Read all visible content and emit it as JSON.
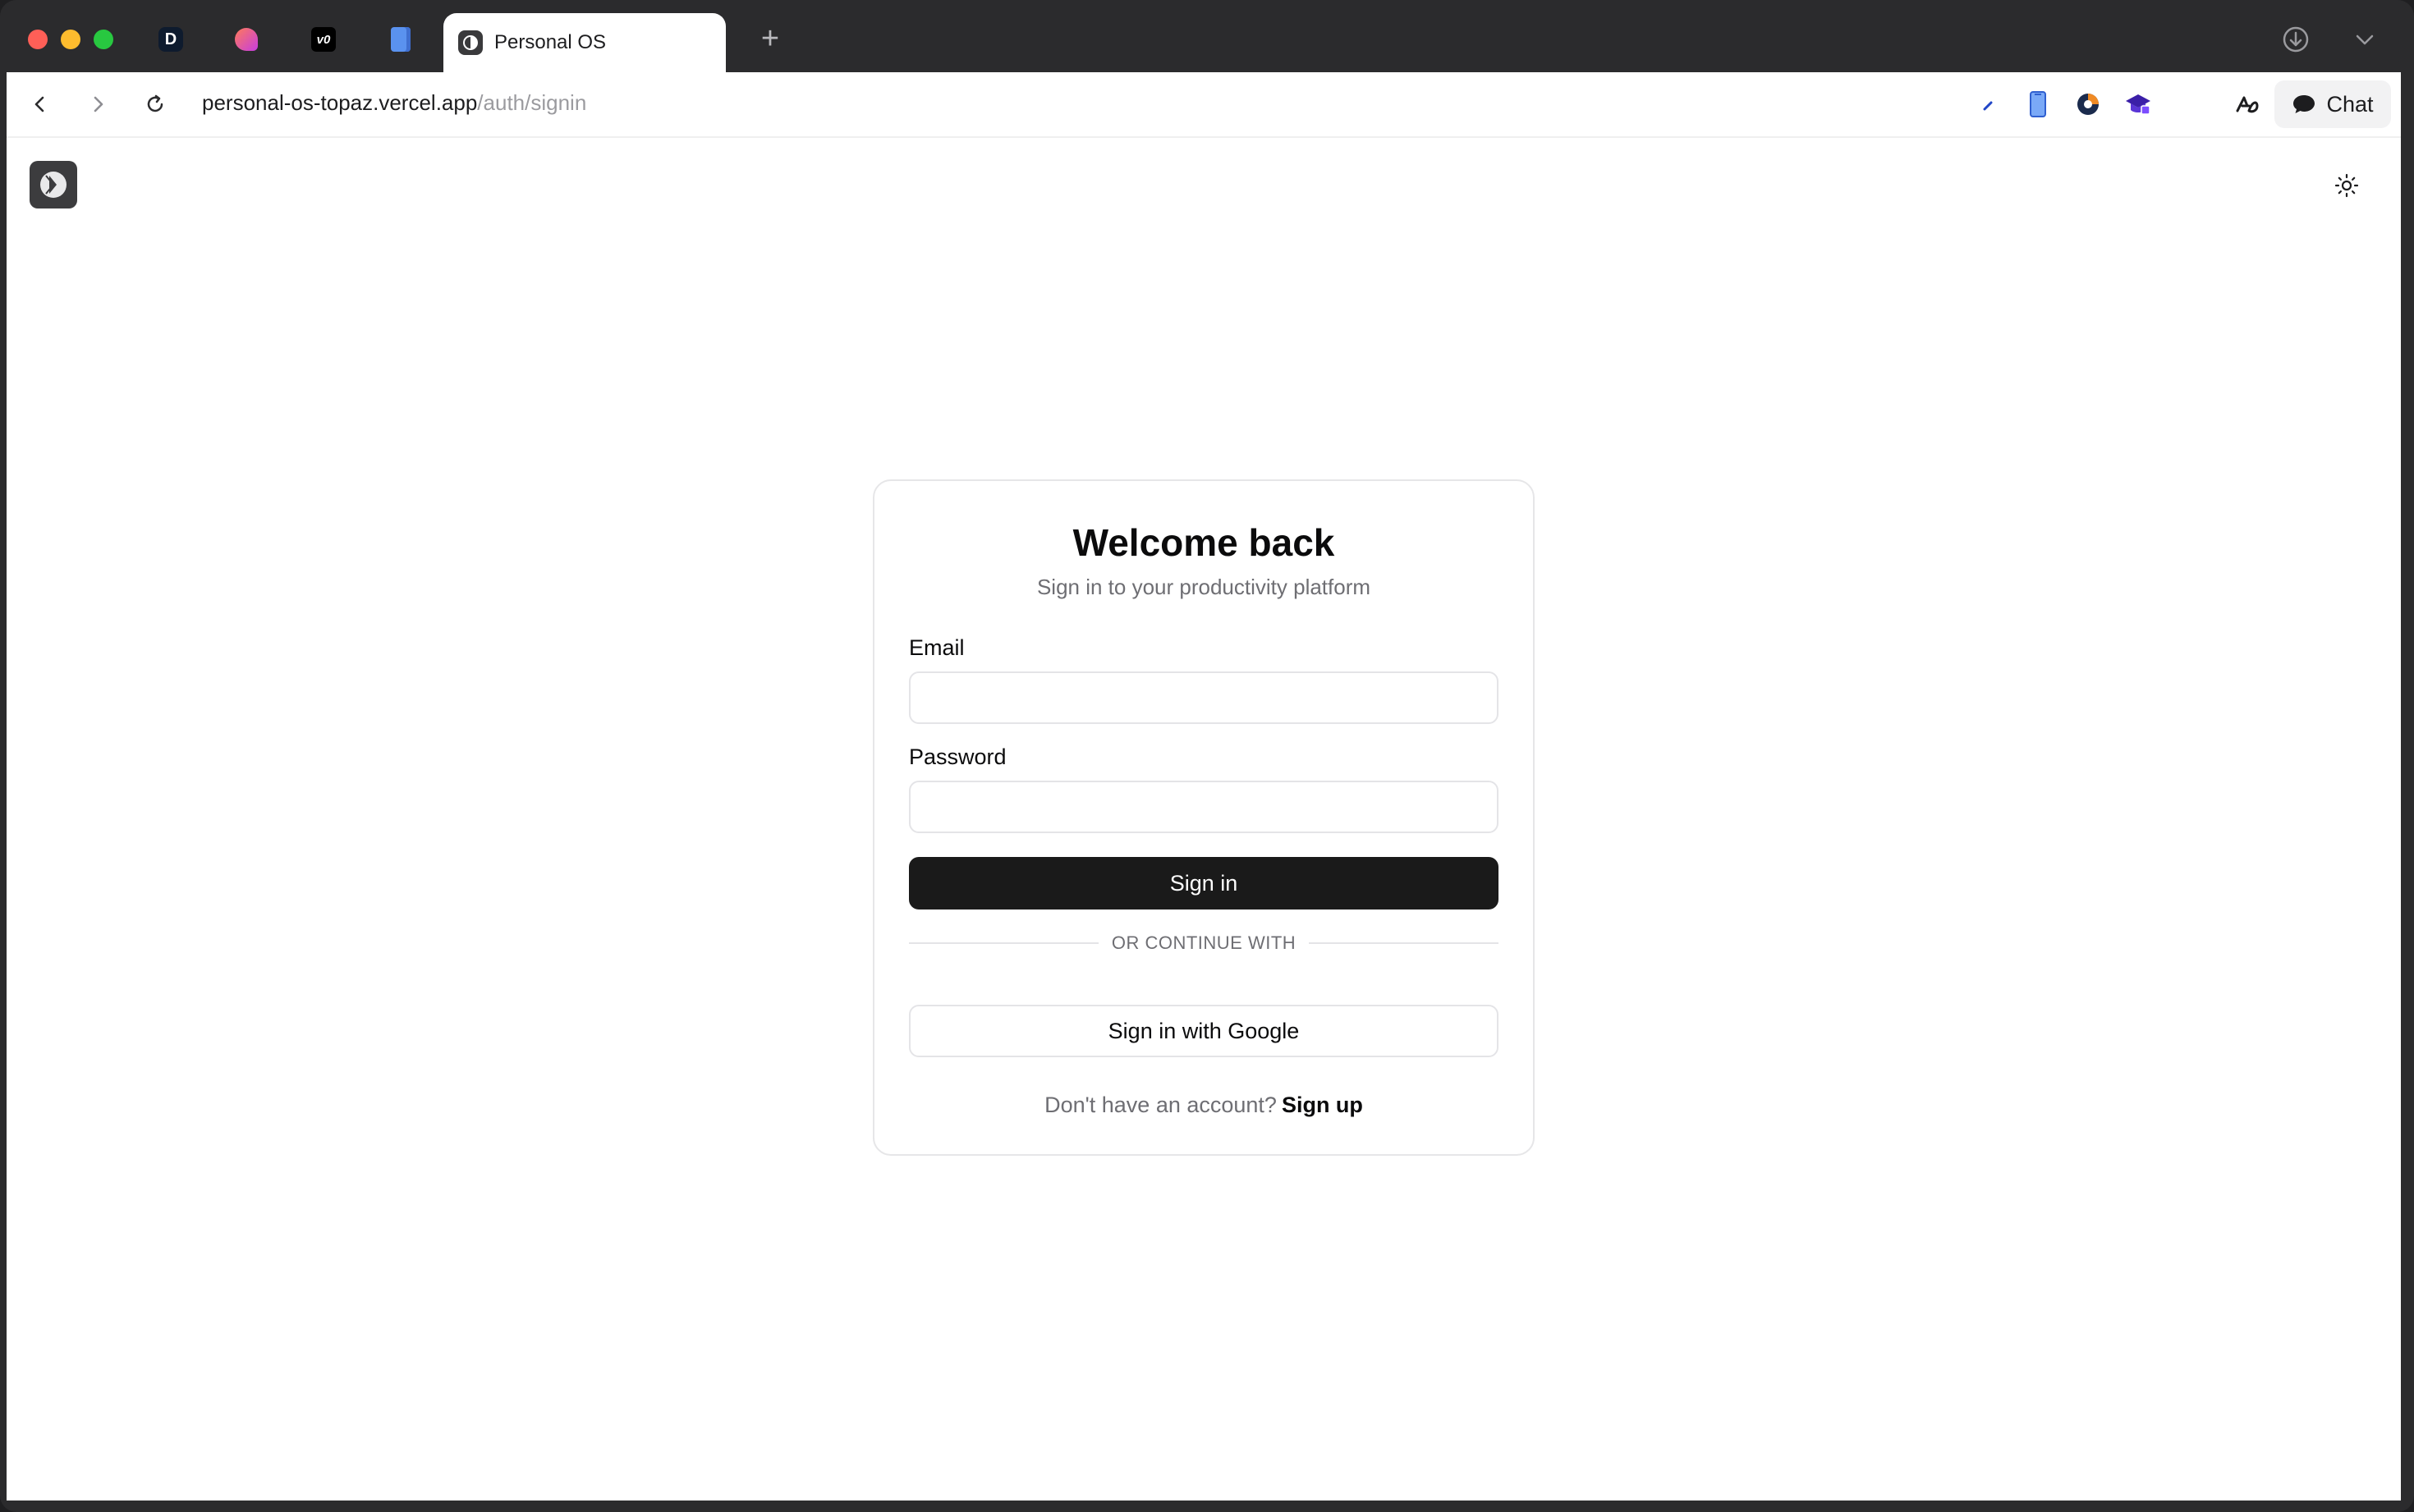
{
  "browser": {
    "tabs": [
      {
        "kind": "pinned",
        "icon": "d-letter-icon",
        "glyph": "D"
      },
      {
        "kind": "pinned",
        "icon": "gradient-heart-icon"
      },
      {
        "kind": "pinned",
        "icon": "v0-logo-icon",
        "glyph": "v0"
      },
      {
        "kind": "pinned",
        "icon": "blue-book-icon"
      }
    ],
    "active_tab": {
      "title": "Personal OS"
    },
    "new_tab_glyph": "+",
    "url": {
      "host": "personal-os-topaz.vercel.app",
      "path": "/auth/signin"
    },
    "chat_label": "Chat"
  },
  "auth": {
    "title": "Welcome back",
    "subtitle": "Sign in to your productivity platform",
    "email_label": "Email",
    "email_value": "",
    "password_label": "Password",
    "password_value": "",
    "sign_in_label": "Sign in",
    "divider_text": "OR CONTINUE WITH",
    "google_label": "Sign in with Google",
    "signup_prompt": "Don't have an account?",
    "signup_link": "Sign up"
  }
}
